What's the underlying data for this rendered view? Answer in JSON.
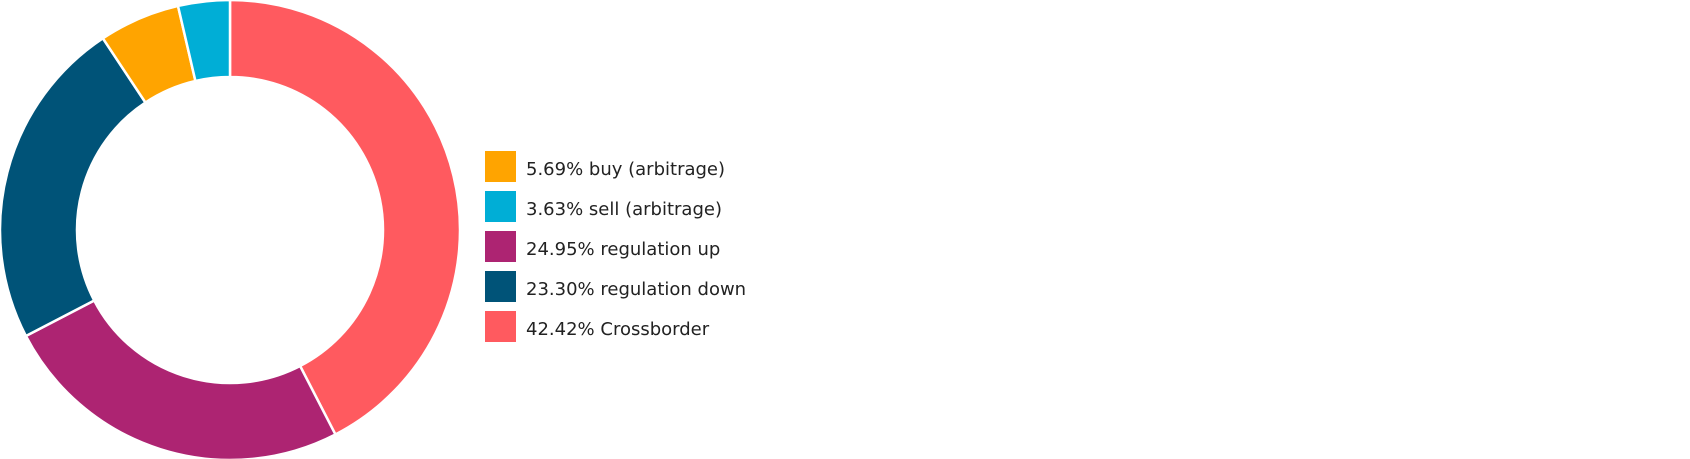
{
  "chart_data": {
    "type": "pie",
    "donut": true,
    "title": "",
    "legend_position": "right",
    "slices": [
      {
        "label": "buy (arbitrage)",
        "percent_label": "5.69%",
        "value": 5.69,
        "color": "#FFA400"
      },
      {
        "label": "sell (arbitrage)",
        "percent_label": "3.63%",
        "value": 3.63,
        "color": "#00AED6"
      },
      {
        "label": "regulation up",
        "percent_label": "24.95%",
        "value": 24.95,
        "color": "#AD2472"
      },
      {
        "label": "regulation down",
        "percent_label": "23.30%",
        "value": 23.3,
        "color": "#005378"
      },
      {
        "label": "Crossborder",
        "percent_label": "42.42%",
        "value": 42.42,
        "color": "#FF5A5F"
      }
    ]
  }
}
